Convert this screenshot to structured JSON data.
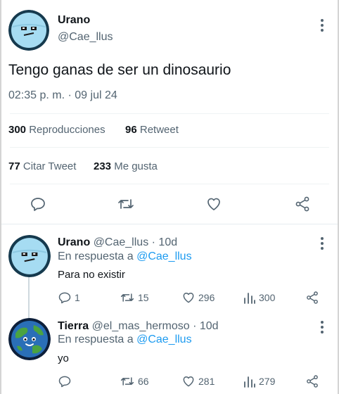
{
  "main_tweet": {
    "author_name": "Urano",
    "author_handle": "@Cae_llus",
    "text": "Tengo ganas de ser un dinosaurio",
    "timestamp": "02:35 p. m. · 09 jul 24",
    "stats": {
      "views_count": "300",
      "views_label": "Reproducciones",
      "retweets_count": "96",
      "retweets_label": "Retweet",
      "quotes_count": "77",
      "quotes_label": "Citar Tweet",
      "likes_count": "233",
      "likes_label": "Me gusta"
    },
    "actions": [
      "reply-icon",
      "retweet-icon",
      "like-icon",
      "share-icon"
    ]
  },
  "replies": [
    {
      "author_name": "Urano",
      "author_handle": "@Cae_llus",
      "age": "· 10d",
      "reply_prefix": "En respuesta a",
      "reply_to": "@Cae_llus",
      "text": "Para no existir",
      "replies_count": "1",
      "retweets_count": "15",
      "likes_count": "296",
      "views_count": "300"
    },
    {
      "author_name": "Tierra",
      "author_handle": "@el_mas_hermoso",
      "age": "· 10d",
      "reply_prefix": "En respuesta a",
      "reply_to": "@Cae_llus",
      "text": "yo",
      "replies_count": "",
      "retweets_count": "66",
      "likes_count": "281",
      "views_count": "279"
    }
  ],
  "colors": {
    "text": "#0f1419",
    "muted": "#536471",
    "link": "#1d9bf0",
    "uranus_blue": "#9fd8ef",
    "earth_ocean": "#2a6fb7",
    "earth_land": "#4aa341"
  }
}
